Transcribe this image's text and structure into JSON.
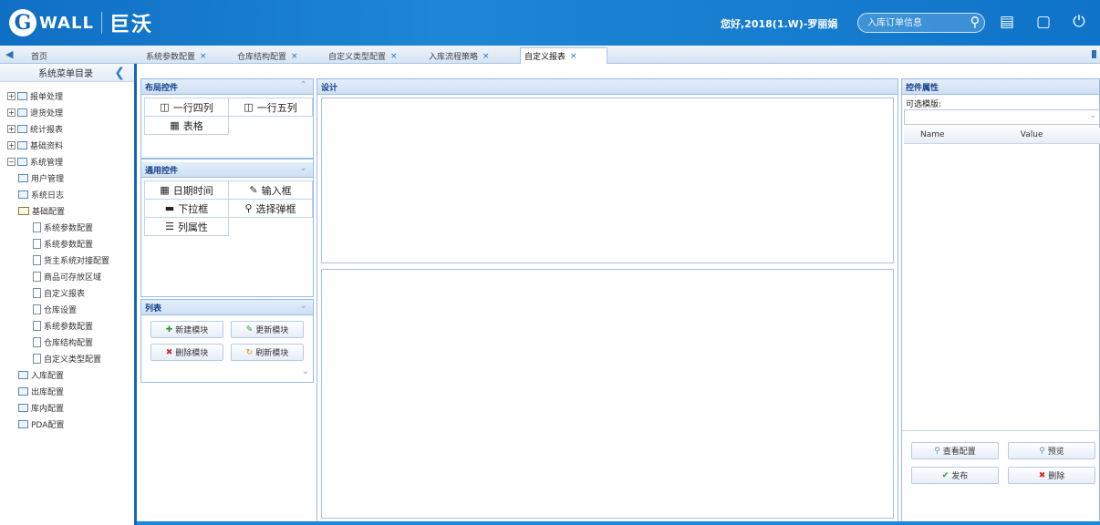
{
  "header": {
    "logo_en": "WALL",
    "logo_g": "G",
    "logo_cn": "巨沃",
    "user_info": "您好,2018(1.W)-罗丽娟",
    "quick_entry_placeholder": "入库订单信息",
    "icons": [
      "search-icon",
      "notes-icon",
      "fullscreen-icon",
      "power-icon"
    ]
  },
  "tabs": [
    {
      "label": "首页",
      "closable": false
    },
    {
      "label": "系统参数配置",
      "closable": true
    },
    {
      "label": "仓库结构配置",
      "closable": true
    },
    {
      "label": "自定义类型配置",
      "closable": true
    },
    {
      "label": "入库流程策略",
      "closable": true
    },
    {
      "label": "自定义报表",
      "closable": true,
      "active": true
    }
  ],
  "sidebar": {
    "title": "系统菜单目录",
    "items": [
      {
        "label": "报单处理",
        "level": 0,
        "expanded": false
      },
      {
        "label": "退货处理",
        "level": 0,
        "expanded": false
      },
      {
        "label": "统计报表",
        "level": 0,
        "expanded": false
      },
      {
        "label": "基础资料",
        "level": 0,
        "expanded": false
      },
      {
        "label": "系统管理",
        "level": 0,
        "expanded": true
      },
      {
        "label": "用户管理",
        "level": 1
      },
      {
        "label": "系统日志",
        "level": 1
      },
      {
        "label": "基础配置",
        "level": 1,
        "folder": true
      },
      {
        "label": "系统参数配置",
        "level": 2
      },
      {
        "label": "系统参数配置",
        "level": 2
      },
      {
        "label": "货主系统对接配置",
        "level": 2
      },
      {
        "label": "商品可存放区域",
        "level": 2
      },
      {
        "label": "自定义报表",
        "level": 2
      },
      {
        "label": "仓库设置",
        "level": 2
      },
      {
        "label": "系统参数配置",
        "level": 2
      },
      {
        "label": "仓库结构配置",
        "level": 2
      },
      {
        "label": "自定义类型配置",
        "level": 2
      },
      {
        "label": "入库配置",
        "level": 1
      },
      {
        "label": "出库配置",
        "level": 1
      },
      {
        "label": "库内配置",
        "level": 1
      },
      {
        "label": "PDA配置",
        "level": 1
      }
    ]
  },
  "layout_panel": {
    "title": "布局控件",
    "buttons": [
      "一行四列",
      "一行五列",
      "表格"
    ]
  },
  "common_panel": {
    "title": "通用控件",
    "buttons": [
      "日期时间",
      "输入框",
      "下拉框",
      "选择弹框",
      "列属性"
    ]
  },
  "list_panel": {
    "title": "列表",
    "buttons": [
      "新建模块",
      "更新模块",
      "删除模块",
      "刷新模块"
    ]
  },
  "design_panel": {
    "title": "设计"
  },
  "props_panel": {
    "title": "控件属性",
    "select_label": "可选模版:",
    "col_name": "Name",
    "col_value": "Value",
    "buttons": [
      "查看配置",
      "预览",
      "发布",
      "删除"
    ]
  }
}
